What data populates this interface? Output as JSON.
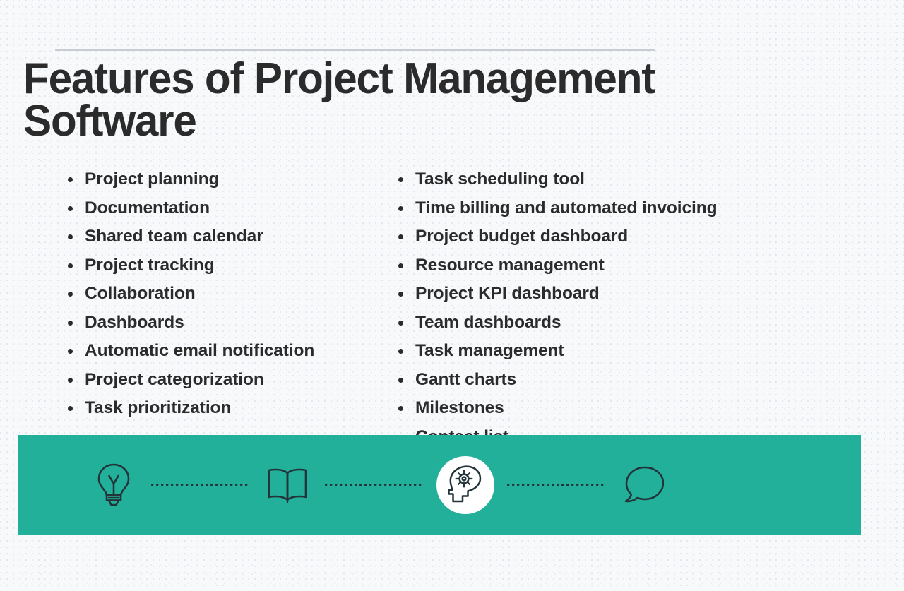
{
  "slide": {
    "background_color": "#f7f9fb",
    "title": "Features of Project Management Software",
    "divider_color": "#c9ccd1",
    "text_color": "#2b2b2b"
  },
  "features": {
    "left_column": [
      {
        "label": "Project planning"
      },
      {
        "label": "Documentation"
      },
      {
        "label": "Shared team calendar"
      },
      {
        "label": "Project tracking"
      },
      {
        "label": "Collaboration"
      },
      {
        "label": "Dashboards"
      },
      {
        "label": "Automatic email notification"
      },
      {
        "label": "Project categorization"
      },
      {
        "label": "Task prioritization"
      }
    ],
    "right_column": [
      {
        "label": "Task scheduling tool"
      },
      {
        "label": "Time billing and automated invoicing"
      },
      {
        "label": "Project budget dashboard"
      },
      {
        "label": "Resource management"
      },
      {
        "label": "Project KPI dashboard"
      },
      {
        "label": "Team dashboards"
      },
      {
        "label": "Task management"
      },
      {
        "label": "Gantt charts"
      },
      {
        "label": "Milestones"
      },
      {
        "label": "Contact list"
      }
    ]
  },
  "footer": {
    "band_color": "#22b09a",
    "icon_color": "#23343a",
    "highlight_circle_color": "#ffffff",
    "icons": [
      {
        "name": "lightbulb-icon",
        "highlighted": false
      },
      {
        "name": "open-book-icon",
        "highlighted": false
      },
      {
        "name": "head-with-gear-icon",
        "highlighted": true
      },
      {
        "name": "speech-bubble-icon",
        "highlighted": false
      }
    ],
    "connectors": [
      {
        "name": "dotted-connector-1",
        "style": "dotted"
      },
      {
        "name": "dotted-connector-2",
        "style": "dotted"
      },
      {
        "name": "dotted-connector-3",
        "style": "dotted"
      }
    ]
  }
}
